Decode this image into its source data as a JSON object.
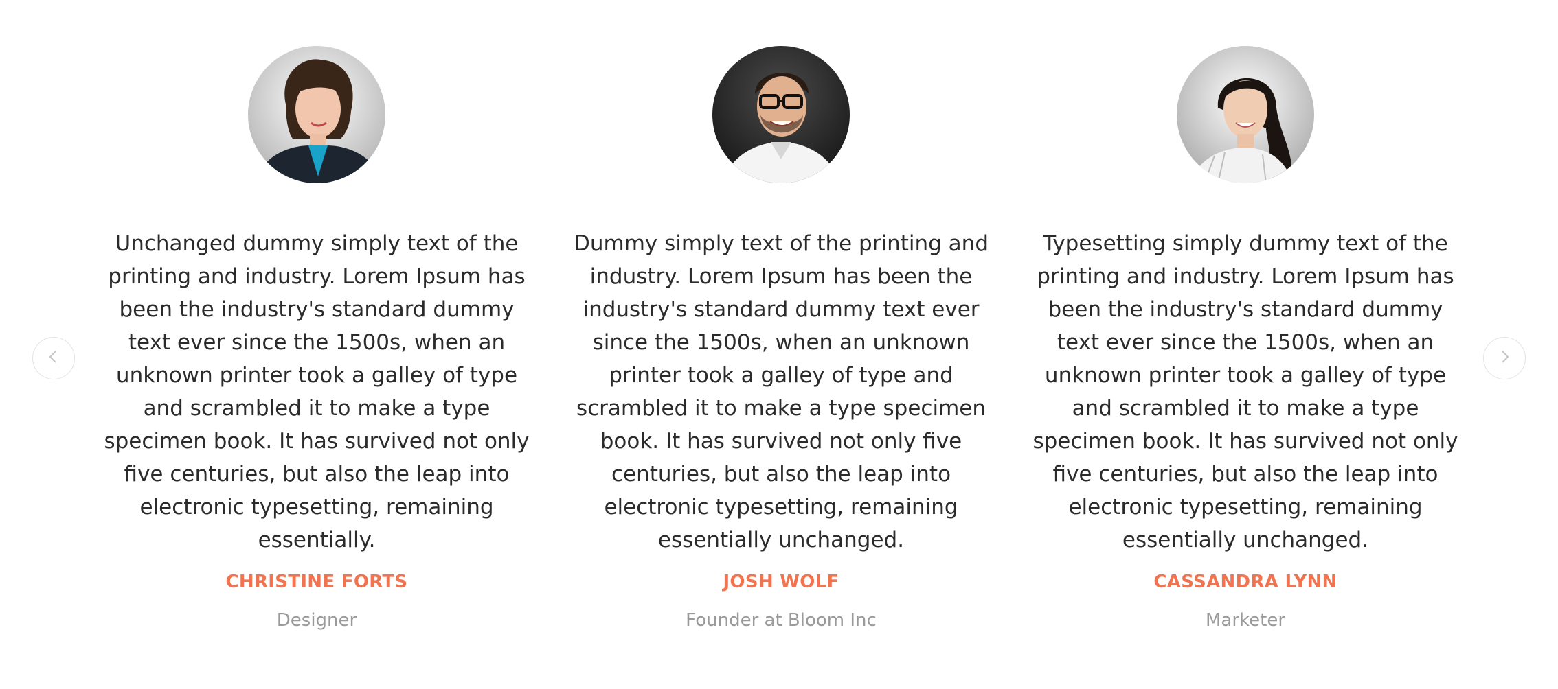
{
  "testimonials": [
    {
      "quote": "Unchanged dummy simply text of the printing and industry. Lorem Ipsum has been the industry's standard dummy text ever since the 1500s, when an unknown printer took a galley of type and scrambled it to make a type specimen book. It has survived not only five centuries, but also the leap into electronic typesetting, remaining essentially.",
      "name": "CHRISTINE FORTS",
      "role": "Designer"
    },
    {
      "quote": "Dummy simply text of the printing and industry. Lorem Ipsum has been the industry's standard dummy text ever since the 1500s, when an unknown printer took a galley of type and scrambled it to make a type specimen book. It has survived not only five centuries, but also the leap into electronic typesetting, remaining essentially unchanged.",
      "name": "JOSH WOLF",
      "role": "Founder at Bloom Inc"
    },
    {
      "quote": "Typesetting simply dummy text of the printing and industry. Lorem Ipsum has been the industry's standard dummy text ever since the 1500s, when an unknown printer took a galley of type and scrambled it to make a type specimen book. It has survived not only five centuries, but also the leap into electronic typesetting, remaining essentially unchanged.",
      "name": "CASSANDRA LYNN",
      "role": "Marketer"
    }
  ],
  "navigation": {
    "prev_icon": "chevron-left-icon",
    "next_icon": "chevron-right-icon"
  },
  "colors": {
    "accent": "#f2734f",
    "text": "#2b2b2b",
    "muted": "#9a9a9a",
    "border": "#e3e3e3"
  }
}
